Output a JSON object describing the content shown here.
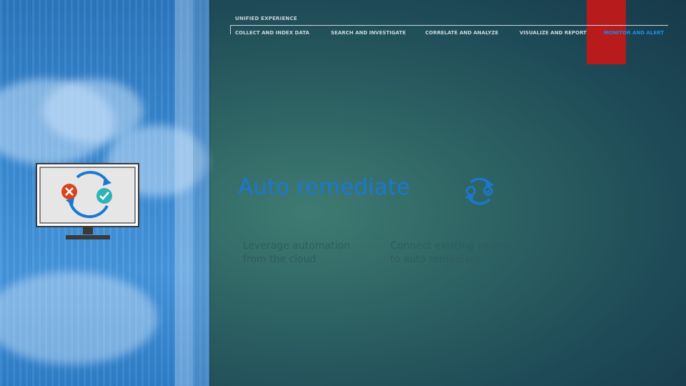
{
  "nav": {
    "section_label": "UNIFIED EXPERIENCE",
    "items": [
      {
        "label": "COLLECT AND INDEX DATA"
      },
      {
        "label": "SEARCH AND INVESTIGATE"
      },
      {
        "label": "CORRELATE AND ANALYZE"
      },
      {
        "label": "VISUALIZE AND REPORT"
      },
      {
        "label": "MONITOR AND ALERT"
      }
    ],
    "active_index": 4
  },
  "main": {
    "title": "Auto remediate",
    "title_icon": "sync-cycle-icon",
    "descriptions": [
      {
        "text": "Leverage automation from the cloud"
      },
      {
        "text": "Connect existing assets to auto remediate"
      }
    ]
  },
  "illustration": {
    "icon": "monitor-remediation-icon",
    "error_icon": "error-x-icon",
    "success_icon": "success-check-icon"
  },
  "colors": {
    "accent": "#1a78d2",
    "active_nav": "#1e8ae6",
    "highlight_tab": "#b71b1b",
    "error": "#d9441c",
    "success": "#2fb3b8"
  }
}
